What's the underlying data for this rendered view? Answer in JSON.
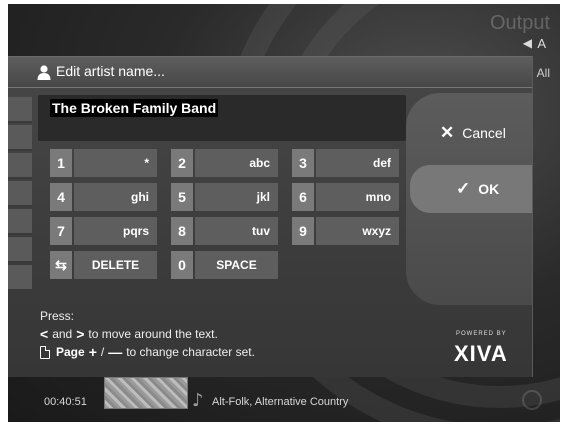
{
  "background": {
    "output_label": "Output",
    "volume_label": "A",
    "filter_label": "All"
  },
  "dialog": {
    "title": "Edit artist name...",
    "text_value": "The Broken Family Band"
  },
  "actions": {
    "cancel_label": "Cancel",
    "ok_label": "OK"
  },
  "keypad": {
    "keys": [
      {
        "digit": "1",
        "letters": "*"
      },
      {
        "digit": "2",
        "letters": "abc"
      },
      {
        "digit": "3",
        "letters": "def"
      },
      {
        "digit": "4",
        "letters": "ghi"
      },
      {
        "digit": "5",
        "letters": "jkl"
      },
      {
        "digit": "6",
        "letters": "mno"
      },
      {
        "digit": "7",
        "letters": "pqrs"
      },
      {
        "digit": "8",
        "letters": "tuv"
      },
      {
        "digit": "9",
        "letters": "wxyz"
      },
      {
        "digit": "⇆",
        "letters": "DELETE"
      },
      {
        "digit": "0",
        "letters": "SPACE"
      }
    ]
  },
  "instructions": {
    "press_label": "Press:",
    "and_label": "and",
    "move_text": "to move around the text.",
    "page_label": "Page",
    "slash_label": "/",
    "charset_text": "to change character set."
  },
  "branding": {
    "powered_by": "POWERED BY",
    "logo_text": "XIVA"
  },
  "status_bar": {
    "time": "00:40:51",
    "genre": "Alt-Folk, Alternative Country"
  },
  "icons": {
    "person": "person-icon",
    "cancel": "x-icon",
    "ok": "checkmark-icon",
    "left_arrow": "chevron-left-icon",
    "right_arrow": "chevron-right-icon",
    "page": "page-icon",
    "plus": "plus-icon",
    "minus": "minus-icon",
    "swap": "swap-arrows-icon",
    "note": "music-note-icon",
    "speaker": "speaker-icon"
  },
  "colors": {
    "background": "#2a2a2a",
    "dialog": "#404040",
    "key_digit": "#7a7a7a",
    "key_letters": "#5e5e5e",
    "ok_highlight": "#787878"
  }
}
